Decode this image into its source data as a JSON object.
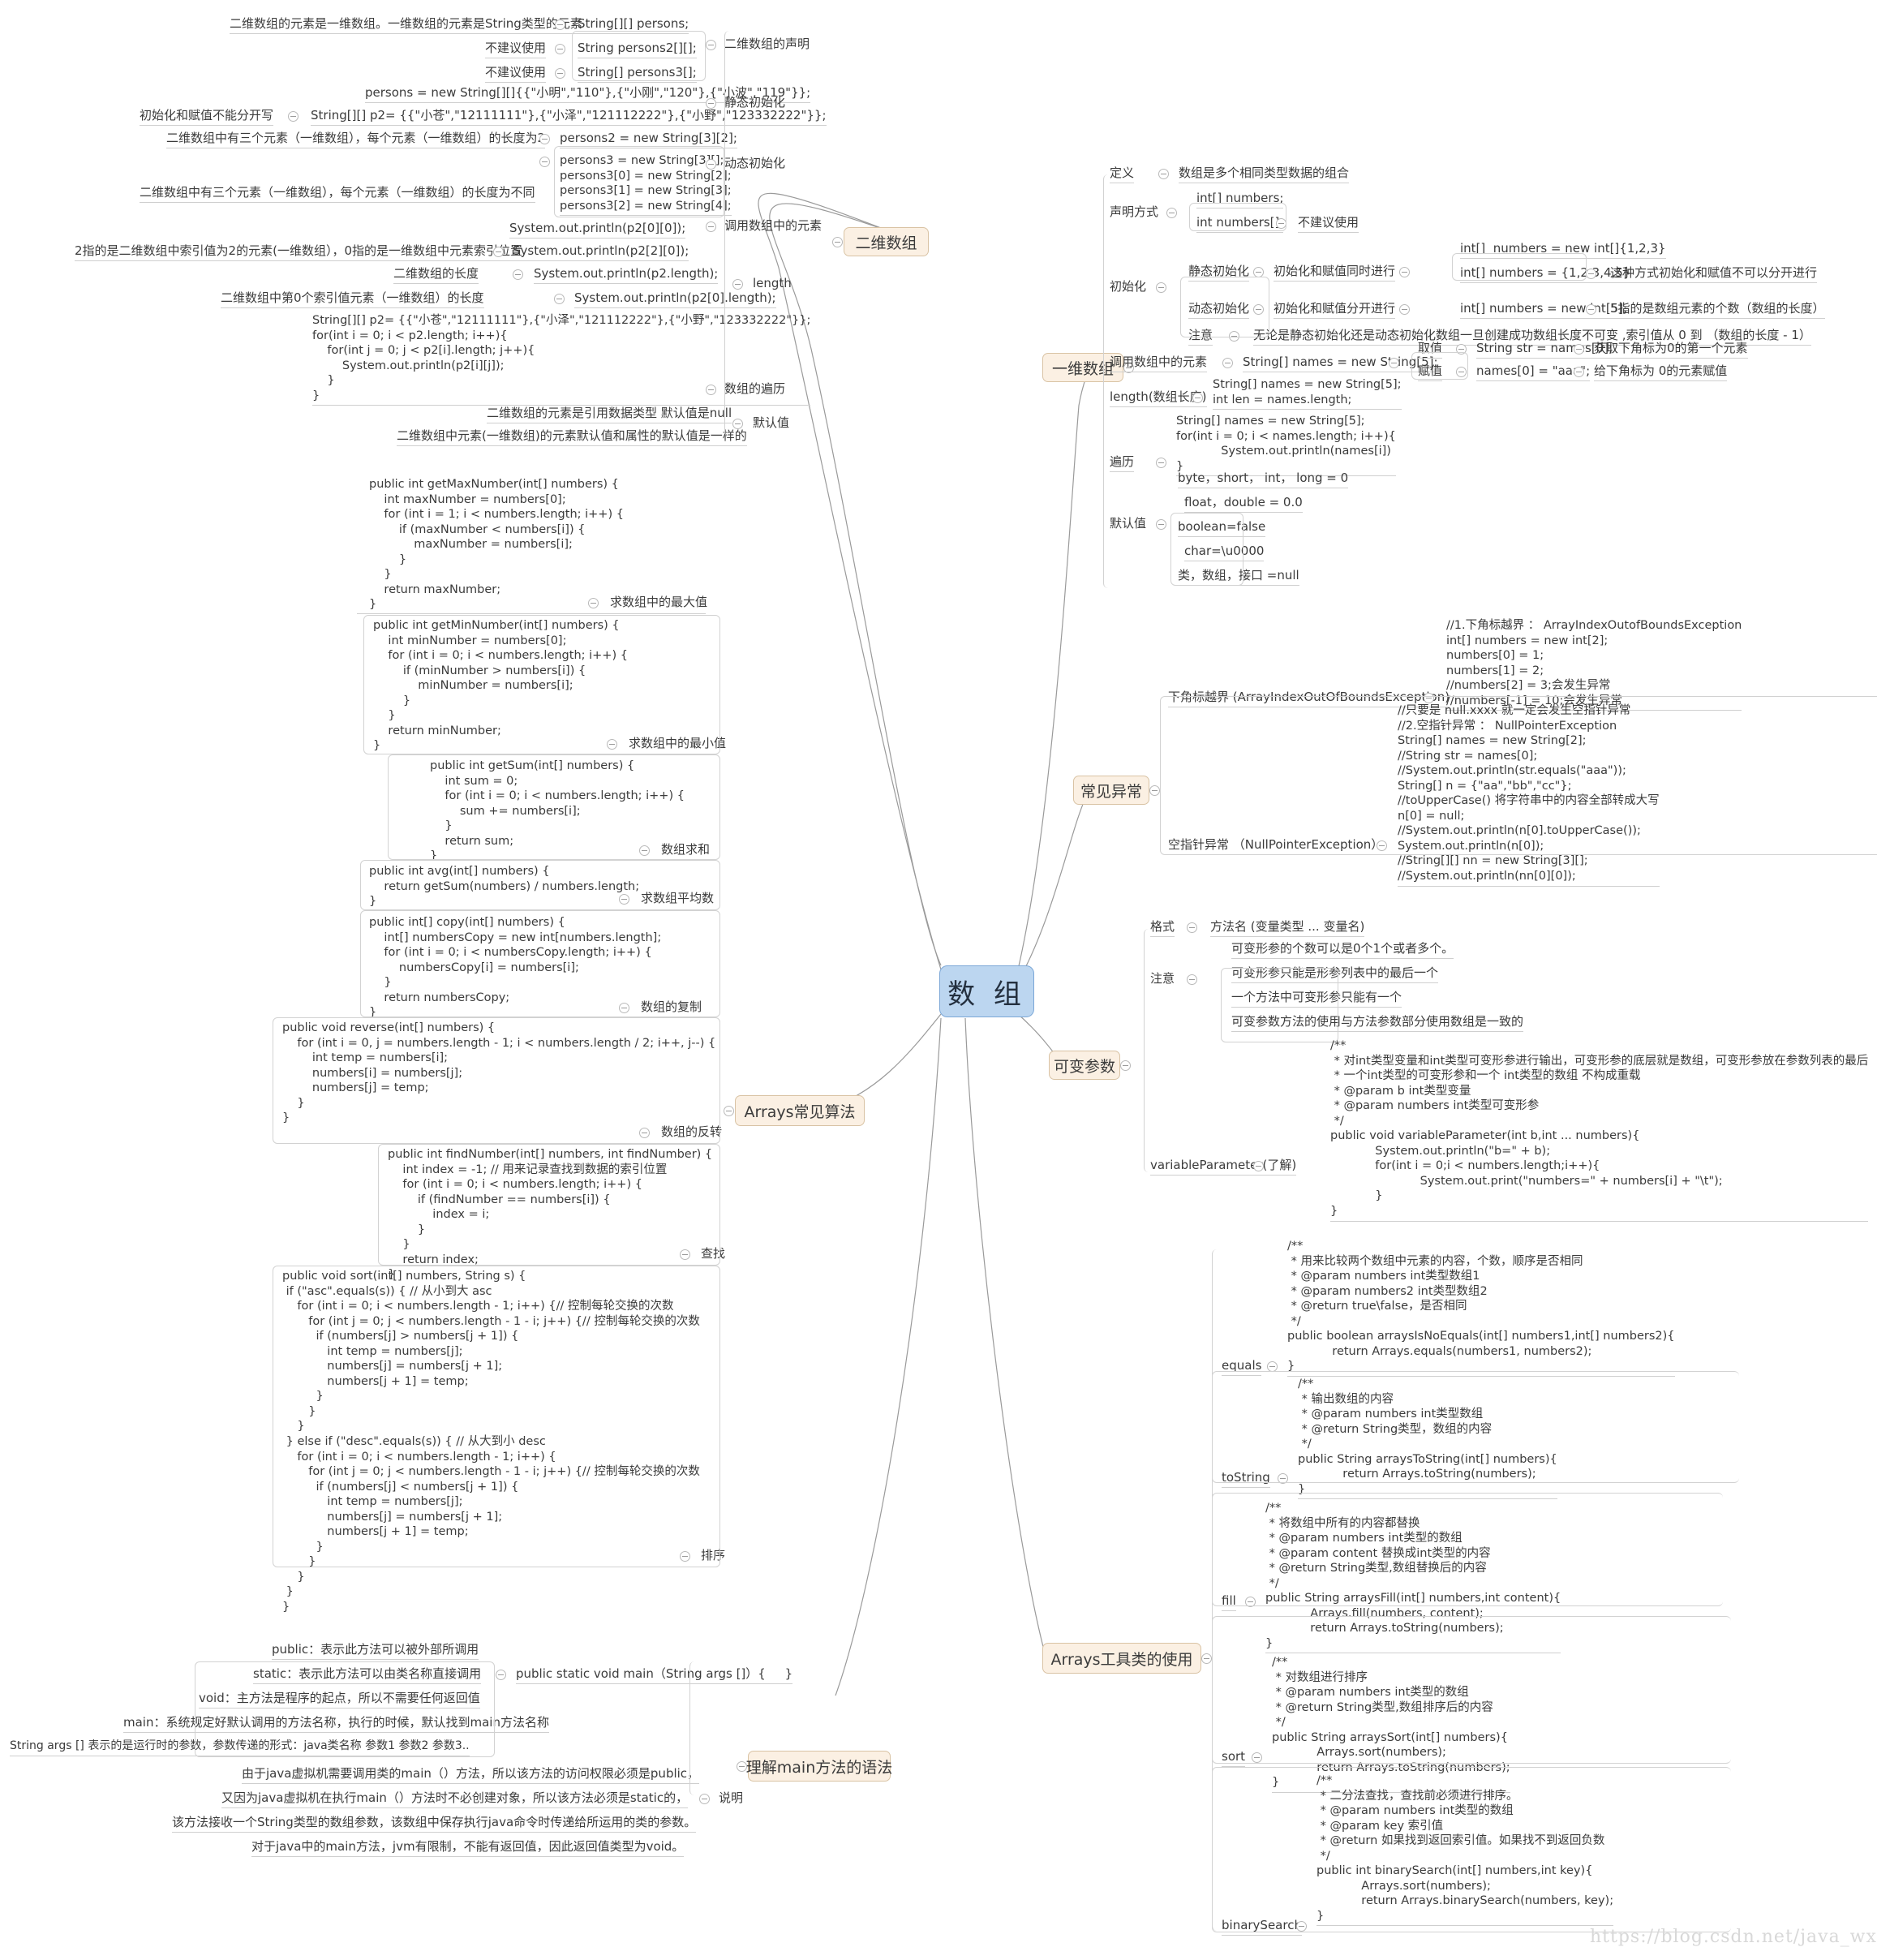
{
  "root": {
    "label": "数 组",
    "color": "#bcd6f0"
  },
  "branch_color": "#fbf0e3",
  "branches": {
    "two_d": "二维数组",
    "one_d": "一维数组",
    "exceptions": "常见异常",
    "varargs": "可变参数",
    "algorithms": "Arrays常见算法",
    "arrays_util": "Arrays工具类的使用",
    "main_syntax": "理解main方法的语法"
  },
  "two_d": {
    "declaration_label": "二维数组的声明",
    "declaration": [
      {
        "desc": "二维数组的元素是一维数组。一维数组的元素是String类型的元素",
        "code": "String[][] persons;"
      },
      {
        "desc": "不建议使用",
        "code": "String persons2[][];"
      },
      {
        "desc": "不建议使用",
        "code": "String[] persons3[];"
      }
    ],
    "static_init_label": "静态初始化",
    "static_init": [
      {
        "code": "persons = new String[][]{{\"小明\",\"110\"},{\"小刚\",\"120\"},{\"小波\",\"119\"}};"
      },
      {
        "desc": "初始化和赋值不能分开写",
        "code": "String[][] p2= {{\"小苍\",\"12111111\"},{\"小泽\",\"121112222\"},{\"小野\",\"123332222\"}};"
      }
    ],
    "dynamic_init_label": "动态初始化",
    "dynamic_init": [
      {
        "desc": "二维数组中有三个元素（一维数组），每个元素（一维数组）的长度为2",
        "code": "persons2 = new String[3][2];"
      },
      {
        "desc": "二维数组中有三个元素（一维数组），每个元素（一维数组）的长度为不同",
        "code": "persons3 = new String[3][];\npersons3[0] = new String[2];\npersons3[1] = new String[3];\npersons3[2] = new String[4];"
      }
    ],
    "call_element_label": "调用数组中的元素",
    "call_element": [
      {
        "code": "System.out.println(p2[0][0]);"
      },
      {
        "desc": "2指的是二维数组中索引值为2的元素(一维数组），0指的是一维数组中元素索引位置",
        "code": "System.out.println(p2[2][0]);"
      }
    ],
    "length_label": "length",
    "length": [
      {
        "desc": "二维数组的长度",
        "code": "System.out.println(p2.length);"
      },
      {
        "desc": "二维数组中第0个索引值元素（一维数组）的长度",
        "code": "System.out.println(p2[0].length);"
      }
    ],
    "traverse_label": "数组的遍历",
    "traverse_code": "String[][] p2= {{\"小苍\",\"12111111\"},{\"小泽\",\"121112222\"},{\"小野\",\"123332222\"}};\nfor(int i = 0; i < p2.length; i++){\n    for(int j = 0; j < p2[i].length; j++){\n        System.out.println(p2[i][j]);\n    }\n}",
    "default_label": "默认值",
    "defaults": [
      "二维数组的元素是引用数据类型 默认值是null",
      "二维数组中元素(一维数组)的元素默认值和属性的默认值是一样的"
    ]
  },
  "one_d": {
    "definition_label": "定义",
    "definition": "数组是多个相同类型数据的组合",
    "declare_label": "声明方式",
    "declare": [
      {
        "code": "int[] numbers;"
      },
      {
        "code": "int numbers[];",
        "desc": "不建议使用"
      }
    ],
    "init_label": "初始化",
    "static_init_label": "静态初始化",
    "static_init_desc": "初始化和赋值同时进行",
    "static_init_items": [
      {
        "code": "int[]  numbers = new int[]{1,2,3}"
      },
      {
        "code": "int[] numbers = {1,2,3,4,5}",
        "desc": "这种方式初始化和赋值不可以分开进行"
      }
    ],
    "dynamic_init_label": "动态初始化",
    "dynamic_init_desc": "初始化和赋值分开进行",
    "dynamic_init_items": [
      {
        "code": "int[] numbers = new int[5];",
        "desc": "5指的是数组元素的个数（数组的长度）"
      }
    ],
    "note_label": "注意",
    "note": "无论是静态初始化还是动态初始化数组一旦创建成功数组长度不可变 ,索引值从 0 到 （数组的长度 - 1）",
    "call_label": "调用数组中的元素",
    "call_code": "String[] names = new String[5];",
    "call_items": [
      {
        "label": "取值",
        "code": "String str = names[0];",
        "desc": "获取下角标为0的第一个元素"
      },
      {
        "label": "赋值",
        "code": "names[0] = \"aaa\";",
        "desc": "给下角标为 0的元素赋值"
      }
    ],
    "length_label": "length(数组长度)",
    "length_code": "String[] names = new String[5];\nint len = names.length;",
    "traverse_label": "遍历",
    "traverse_code": "String[] names = new String[5];\nfor(int i = 0; i < names.length; i++){\n            System.out.println(names[i])\n}",
    "default_label": "默认值",
    "defaults": [
      "byte，short， int， long = 0",
      "float，double = 0.0",
      "boolean=false",
      "char=\\u0000",
      "类，数组，接口 =null"
    ]
  },
  "exceptions": {
    "index_label": "下角标越界 (ArrayIndexOutOfBoundsException)",
    "index_code": "//1.下角标越界 ： ArrayIndexOutofBoundsException\nint[] numbers = new int[2];\nnumbers[0] = 1;\nnumbers[1] = 2;\n//numbers[2] = 3;会发生异常\n//numbers[-1] = 10;会发生异常",
    "null_label": "空指针异常 （NullPointerException）",
    "null_code": "//只要是 null.xxxx 就一定会发生空指针异常\n//2.空指针异常 ： NullPointerException\nString[] names = new String[2];\n//String str = names[0];\n//System.out.println(str.equals(\"aaa\"));\nString[] n = {\"aa\",\"bb\",\"cc\"};\n//toUpperCase() 将字符串中的内容全部转成大写\nn[0] = null;\n//System.out.println(n[0].toUpperCase());\nSystem.out.println(n[0]);\n//String[][] nn = new String[3][];\n//System.out.println(nn[0][0]);"
  },
  "varargs": {
    "format_label": "格式",
    "format": "方法名 (变量类型 ... 变量名)",
    "note_label": "注意",
    "notes": [
      "可变形参的个数可以是0个1个或者多个。",
      "可变形参只能是形参列表中的最后一个",
      "一个方法中可变形参只能有一个",
      "可变参数方法的使用与方法参数部分使用数组是一致的"
    ],
    "example_label": "variableParameter(了解)",
    "example_code": "/**\n * 对int类型变量和int类型可变形参进行输出，可变形参的底层就是数组，可变形参放在参数列表的最后\n * 一个int类型的可变形参和一个 int类型的数组 不构成重载\n * @param b int类型变量\n * @param numbers int类型可变形参\n */\npublic void variableParameter(int b,int ... numbers){\n            System.out.println(\"b=\" + b);\n            for(int i = 0;i < numbers.length;i++){\n                        System.out.print(\"numbers=\" + numbers[i] + \"\\t\");\n            }\n}"
  },
  "algorithms": {
    "max_label": "求数组中的最大值",
    "max_code": "public int getMaxNumber(int[] numbers) {\n    int maxNumber = numbers[0];\n    for (int i = 1; i < numbers.length; i++) {\n        if (maxNumber < numbers[i]) {\n            maxNumber = numbers[i];\n        }\n    }\n    return maxNumber;\n}",
    "min_label": "求数组中的最小值",
    "min_code": "public int getMinNumber(int[] numbers) {\n    int minNumber = numbers[0];\n    for (int i = 0; i < numbers.length; i++) {\n        if (minNumber > numbers[i]) {\n            minNumber = numbers[i];\n        }\n    }\n    return minNumber;\n}",
    "sum_label": "数组求和",
    "sum_code": "public int getSum(int[] numbers) {\n    int sum = 0;\n    for (int i = 0; i < numbers.length; i++) {\n        sum += numbers[i];\n    }\n    return sum;\n}",
    "avg_label": "求数组平均数",
    "avg_code": "public int avg(int[] numbers) {\n    return getSum(numbers) / numbers.length;\n}",
    "copy_label": "数组的复制",
    "copy_code": "public int[] copy(int[] numbers) {\n    int[] numbersCopy = new int[numbers.length];\n    for (int i = 0; i < numbersCopy.length; i++) {\n        numbersCopy[i] = numbers[i];\n    }\n    return numbersCopy;\n}",
    "reverse_label": "数组的反转",
    "reverse_code": "public void reverse(int[] numbers) {\n    for (int i = 0, j = numbers.length - 1; i < numbers.length / 2; i++, j--) {\n        int temp = numbers[i];\n        numbers[i] = numbers[j];\n        numbers[j] = temp;\n    }\n}",
    "find_label": "查找",
    "find_code": "public int findNumber(int[] numbers, int findNumber) {\n    int index = -1; // 用来记录查找到数据的索引位置\n    for (int i = 0; i < numbers.length; i++) {\n        if (findNumber == numbers[i]) {\n            index = i;\n        }\n    }\n    return index;\n}",
    "sort_label": "排序",
    "sort_code": "public void sort(int[] numbers, String s) {\n if (\"asc\".equals(s)) { // 从小到大 asc\n    for (int i = 0; i < numbers.length - 1; i++) {// 控制每轮交换的次数\n       for (int j = 0; j < numbers.length - 1 - i; j++) {// 控制每轮交换的次数\n         if (numbers[j] > numbers[j + 1]) {\n            int temp = numbers[j];\n            numbers[j] = numbers[j + 1];\n            numbers[j + 1] = temp;\n         }\n       }\n    }\n } else if (\"desc\".equals(s)) { // 从大到小 desc\n    for (int i = 0; i < numbers.length - 1; i++) {\n       for (int j = 0; j < numbers.length - 1 - i; j++) {// 控制每轮交换的次数\n         if (numbers[j] < numbers[j + 1]) {\n            int temp = numbers[j];\n            numbers[j] = numbers[j + 1];\n            numbers[j + 1] = temp;\n         }\n       }\n    }\n }\n}"
  },
  "arrays_util": {
    "equals_label": "equals",
    "equals_code": "/**\n * 用来比较两个数组中元素的内容，个数，顺序是否相同\n * @param numbers int类型数组1\n * @param numbers2 int类型数组2\n * @return true\\false，是否相同\n */\npublic boolean arraysIsNoEquals(int[] numbers1,int[] numbers2){\n            return Arrays.equals(numbers1, numbers2);\n}",
    "tostring_label": "toString",
    "tostring_code": "/**\n * 输出数组的内容\n * @param numbers int类型数组\n * @return String类型，数组的内容\n */\npublic String arraysToString(int[] numbers){\n            return Arrays.toString(numbers);\n}",
    "fill_label": "fill",
    "fill_code": "/**\n * 将数组中所有的内容都替换\n * @param numbers int类型的数组\n * @param content 替换成int类型的内容\n * @return String类型,数组替换后的内容\n */\npublic String arraysFill(int[] numbers,int content){\n            Arrays.fill(numbers, content);\n            return Arrays.toString(numbers);\n}",
    "sort_label": "sort",
    "sort_code": "/**\n * 对数组进行排序\n * @param numbers int类型的数组\n * @return String类型,数组排序后的内容\n */\npublic String arraysSort(int[] numbers){\n            Arrays.sort(numbers);\n            return Arrays.toString(numbers);\n}",
    "binary_label": "binarySearch",
    "binary_code": "/**\n * 二分法查找，查找前必须进行排序。\n * @param numbers int类型的数组\n * @param key 索引值\n * @return 如果找到返回索引值。如果找不到返回负数\n */\npublic int binarySearch(int[] numbers,int key){\n            Arrays.sort(numbers);\n            return Arrays.binarySearch(numbers, key);\n}"
  },
  "main_syntax": {
    "signature": "public static void main（String args []）{     }",
    "parts": [
      "public：表示此方法可以被外部所调用",
      "static：表示此方法可以由类名称直接调用",
      "void：主方法是程序的起点，所以不需要任何返回值",
      "main：系统规定好默认调用的方法名称，执行的时候，默认找到main方法名称",
      "String args [] 表示的是运行时的参数，参数传递的形式：java类名称 参数1 参数2 参数3.."
    ],
    "explain_label": "说明",
    "explains": [
      "由于java虚拟机需要调用类的main（）方法，所以该方法的访问权限必须是public，",
      "又因为java虚拟机在执行main（）方法时不必创建对象，所以该方法必须是static的，",
      "该方法接收一个String类型的数组参数，该数组中保存执行java命令时传递给所运用的类的参数。",
      "对于java中的main方法，jvm有限制，不能有返回值，因此返回值类型为void。"
    ]
  },
  "watermark": "https://blog.csdn.net/java_wxid"
}
